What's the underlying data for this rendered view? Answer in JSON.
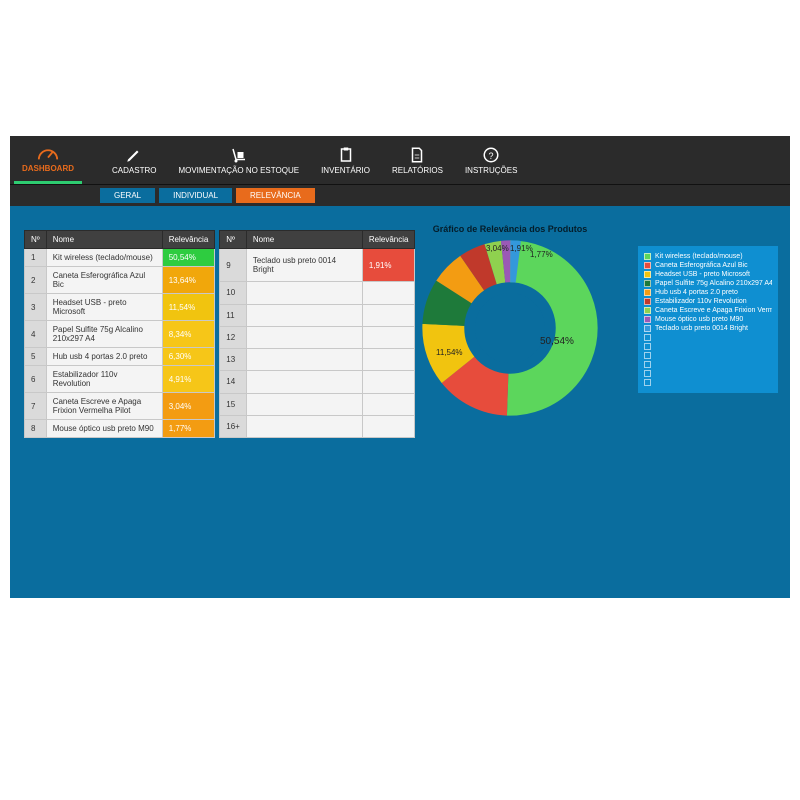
{
  "nav": {
    "dashboard": "DASHBOARD",
    "cadastro": "CADASTRO",
    "mov": "MOVIMENTAÇÃO NO ESTOQUE",
    "inv": "INVENTÁRIO",
    "rel": "RELATÓRIOS",
    "inst": "INSTRUÇÕES"
  },
  "tabs": {
    "geral": "GERAL",
    "individual": "INDIVIDUAL",
    "relevancia": "RELEVÂNCIA"
  },
  "table": {
    "hdr_n": "Nº",
    "hdr_nome": "Nome",
    "hdr_rel": "Relevância",
    "left": [
      {
        "n": "1",
        "nome": "Kit wireless (teclado/mouse)",
        "rel": "50,54%",
        "bg": "#2ecc40"
      },
      {
        "n": "2",
        "nome": "Caneta Esferográfica Azul Bic",
        "rel": "13,64%",
        "bg": "#f1a70b"
      },
      {
        "n": "3",
        "nome": "Headset USB - preto Microsoft",
        "rel": "11,54%",
        "bg": "#f1c40f"
      },
      {
        "n": "4",
        "nome": "Papel Sulfite 75g Alcalino 210x297 A4",
        "rel": "8,34%",
        "bg": "#f6c618"
      },
      {
        "n": "5",
        "nome": "Hub usb 4 portas 2.0 preto",
        "rel": "6,30%",
        "bg": "#f6c618"
      },
      {
        "n": "6",
        "nome": "Estabilizador 110v Revolution",
        "rel": "4,91%",
        "bg": "#f6c618"
      },
      {
        "n": "7",
        "nome": "Caneta Escreve e Apaga Frixion Vermelha Pilot",
        "rel": "3,04%",
        "bg": "#f39c12"
      },
      {
        "n": "8",
        "nome": "Mouse óptico usb preto M90",
        "rel": "1,77%",
        "bg": "#f39c12"
      }
    ],
    "right": [
      {
        "n": "9",
        "nome": "Teclado usb preto 0014 Bright",
        "rel": "1,91%",
        "bg": "#e74c3c"
      },
      {
        "n": "10",
        "nome": "",
        "rel": "",
        "bg": ""
      },
      {
        "n": "11",
        "nome": "",
        "rel": "",
        "bg": ""
      },
      {
        "n": "12",
        "nome": "",
        "rel": "",
        "bg": ""
      },
      {
        "n": "13",
        "nome": "",
        "rel": "",
        "bg": ""
      },
      {
        "n": "14",
        "nome": "",
        "rel": "",
        "bg": ""
      },
      {
        "n": "15",
        "nome": "",
        "rel": "",
        "bg": ""
      },
      {
        "n": "16+",
        "nome": "",
        "rel": "",
        "bg": ""
      }
    ]
  },
  "chart_title": "Gráfico de Relevância dos Produtos",
  "chart_data": {
    "type": "pie",
    "title": "Gráfico de Relevância dos Produtos",
    "series": [
      {
        "name": "Kit wireless (teclado/mouse)",
        "value": 50.54,
        "color": "#5cd65c"
      },
      {
        "name": "Caneta Esferográfica Azul Bic",
        "value": 13.64,
        "color": "#e74c3c"
      },
      {
        "name": "Headset USB - preto Microsoft",
        "value": 11.54,
        "color": "#f1c40f"
      },
      {
        "name": "Papel Sulfite 75g Alcalino 210x297 A4",
        "value": 8.34,
        "color": "#1e7a3a"
      },
      {
        "name": "Hub usb 4 portas 2.0 preto",
        "value": 6.3,
        "color": "#f39c12"
      },
      {
        "name": "Estabilizador 110v Revolution",
        "value": 4.91,
        "color": "#c0392b"
      },
      {
        "name": "Caneta Escreve e Apaga Frixion Vermelha Pilot",
        "value": 3.04,
        "color": "#8fd14f"
      },
      {
        "name": "Mouse óptico usb preto M90",
        "value": 1.77,
        "color": "#9b59b6"
      },
      {
        "name": "Teclado usb preto 0014 Bright",
        "value": 1.91,
        "color": "#3498db"
      }
    ],
    "visible_labels": [
      "50,54%",
      "11,54%",
      "1,91%",
      "3,04%",
      "1,77%"
    ]
  },
  "legend": [
    {
      "c": "#5cd65c",
      "t": "Kit wireless (teclado/mouse)"
    },
    {
      "c": "#e74c3c",
      "t": "Caneta Esferográfica Azul Bic"
    },
    {
      "c": "#f1c40f",
      "t": "Headset USB - preto Microsoft"
    },
    {
      "c": "#1e7a3a",
      "t": "Papel Sulfite 75g Alcalino 210x297 A4"
    },
    {
      "c": "#f39c12",
      "t": "Hub usb 4 portas 2.0 preto"
    },
    {
      "c": "#c0392b",
      "t": "Estabilizador 110v Revolution"
    },
    {
      "c": "#8fd14f",
      "t": "Caneta Escreve e Apaga Frixion Vermelha Pilot"
    },
    {
      "c": "#9b59b6",
      "t": "Mouse óptico usb preto M90"
    },
    {
      "c": "#3498db",
      "t": "Teclado usb preto 0014 Bright"
    },
    {
      "c": "#0f8fd1",
      "t": ""
    },
    {
      "c": "#0f8fd1",
      "t": ""
    },
    {
      "c": "#0f8fd1",
      "t": ""
    },
    {
      "c": "#0f8fd1",
      "t": ""
    },
    {
      "c": "#0f8fd1",
      "t": ""
    },
    {
      "c": "#0f8fd1",
      "t": ""
    }
  ]
}
